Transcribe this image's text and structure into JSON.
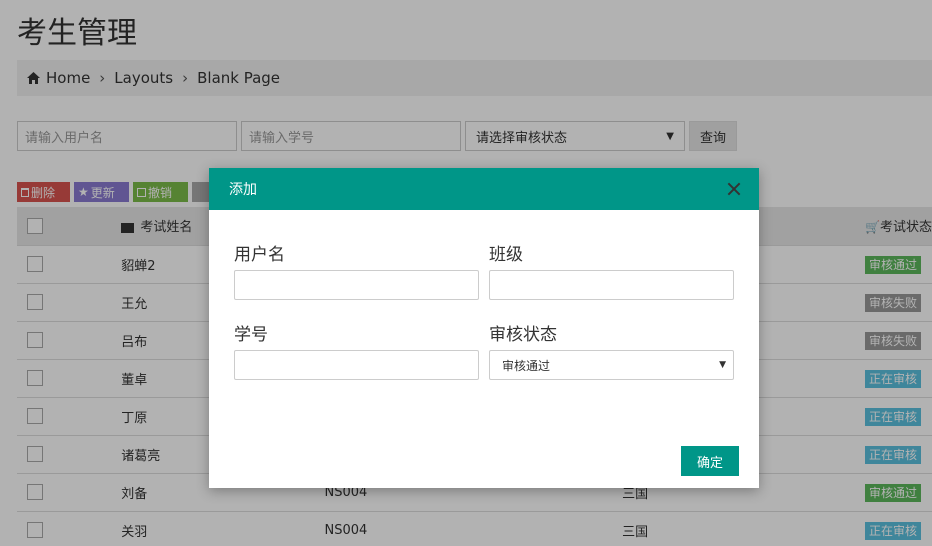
{
  "page_title": "考生管理",
  "breadcrumb": {
    "items": [
      "Home",
      "Layouts",
      "Blank Page"
    ]
  },
  "search": {
    "username_placeholder": "请输入用户名",
    "student_id_placeholder": "请输入学号",
    "status_select_value": "请选择审核状态",
    "query_label": "查询"
  },
  "actions": {
    "delete_label": "删除",
    "update_label": "更新",
    "revoke_label": "撤销"
  },
  "table": {
    "headers": {
      "name": "考试姓名",
      "status": "考试状态"
    },
    "rows": [
      {
        "name": "貂蝉2",
        "id": "",
        "class": "",
        "status": "审核通过",
        "status_color": "#5cb85c"
      },
      {
        "name": "王允",
        "id": "",
        "class": "",
        "status": "审核失败",
        "status_color": "#999999"
      },
      {
        "name": "吕布",
        "id": "",
        "class": "",
        "status": "审核失败",
        "status_color": "#999999"
      },
      {
        "name": "董卓",
        "id": "",
        "class": "",
        "status": "正在审核",
        "status_color": "#5bc0de"
      },
      {
        "name": "丁原",
        "id": "",
        "class": "",
        "status": "正在审核",
        "status_color": "#5bc0de"
      },
      {
        "name": "诸葛亮",
        "id": "",
        "class": "",
        "status": "正在审核",
        "status_color": "#5bc0de"
      },
      {
        "name": "刘备",
        "id": "NS004",
        "class": "三国",
        "status": "审核通过",
        "status_color": "#5cb85c"
      },
      {
        "name": "关羽",
        "id": "NS004",
        "class": "三国",
        "status": "正在审核",
        "status_color": "#5bc0de"
      }
    ]
  },
  "modal": {
    "title": "添加",
    "username_label": "用户名",
    "class_label": "班级",
    "student_id_label": "学号",
    "status_label": "审核状态",
    "status_value": "审核通过",
    "confirm_label": "确定",
    "accent_color": "#009688"
  },
  "icons": {
    "home": "home-icon",
    "briefcase": "briefcase-icon",
    "cart": "cart-icon",
    "close": "close-icon",
    "caret": "caret-down-icon"
  }
}
